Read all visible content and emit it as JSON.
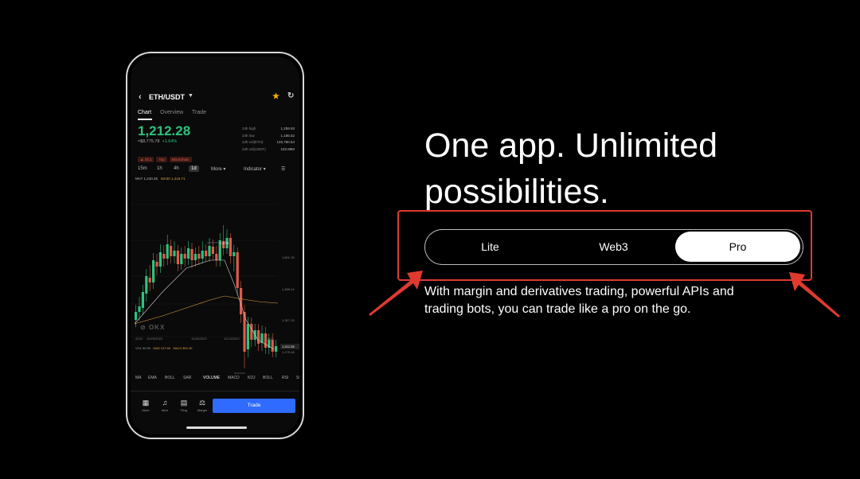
{
  "phone": {
    "pair": "ETH/USDT",
    "tabs": [
      "Chart",
      "Overview",
      "Trade"
    ],
    "price": "1,212.28",
    "price_change": "≈$8,775.78",
    "price_pct": "+1.64%",
    "stats": [
      {
        "label": "24h high",
        "value": "1,259.93"
      },
      {
        "label": "24h low",
        "value": "1,186.62"
      },
      {
        "label": "24h vol(ETH)",
        "value": "149,780.54"
      },
      {
        "label": "24h vol(USDT)",
        "value": "182.89M"
      }
    ],
    "tags": [
      "▲ 33.1",
      "Top",
      "Blockchain"
    ],
    "intervals": [
      "15m",
      "1h",
      "4h",
      "1d",
      "More ▾",
      "Indicator ▾"
    ],
    "active_interval": "1d",
    "ma_legend": {
      "ma7": "MA7 1,240.25",
      "ma30": "MA30 1,416.71"
    },
    "y_ticks": [
      "1,601.15",
      "1,459.14",
      "1,317.13",
      "1,212.28",
      "1,175.16",
      "1,033.11"
    ],
    "chart_labels": {
      "high": "1,676",
      "low": "1,071.9"
    },
    "watermark": "OKX",
    "x_dates": [
      "2022",
      "10/29/2022",
      "11/06/2022",
      "11/13/2022",
      "11/16/2022"
    ],
    "vol_legend": {
      "vol": "VOL 50.9K",
      "ma5": "MA5 137.6K",
      "ma10": "MA10 383.2K"
    },
    "vol_ticks": [
      "697.9K",
      "348.9K",
      "0.00"
    ],
    "indicators": [
      "MA",
      "EMA",
      "BOLL",
      "SAR",
      "VOLUME",
      "MACD",
      "KDJ",
      "BOLL",
      "RSI",
      "St"
    ],
    "active_indicator": "VOLUME",
    "nav": [
      {
        "label": "More",
        "icon": "grid-icon"
      },
      {
        "label": "Alert",
        "icon": "bell-icon"
      },
      {
        "label": "Ping",
        "icon": "document-icon"
      },
      {
        "label": "Margin",
        "icon": "margin-icon"
      }
    ],
    "trade_button": "Trade"
  },
  "headline": "One app. Unlimited possibilities.",
  "mode_switch": {
    "options": [
      "Lite",
      "Web3",
      "Pro"
    ],
    "selected": "Pro"
  },
  "description": "With margin and derivatives trading, powerful APIs and trading bots, you can trade like a pro on the go.",
  "colors": {
    "up": "#2ec27e",
    "down": "#e05a4a",
    "accent": "#2f6bff",
    "highlight": "#e03a2f"
  }
}
